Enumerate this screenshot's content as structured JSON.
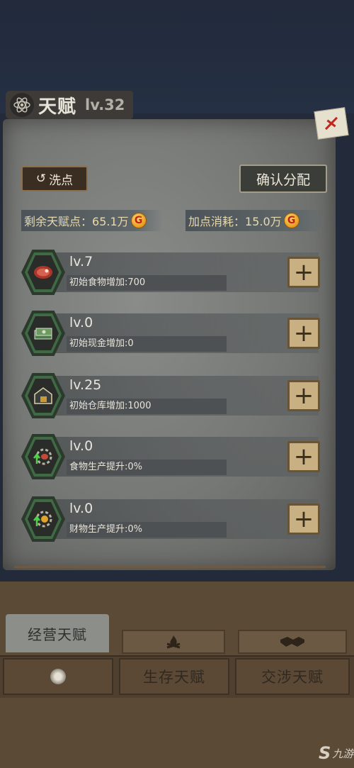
{
  "header": {
    "title": "天赋",
    "level": "lv.32"
  },
  "actions": {
    "reset_label": "洗点",
    "confirm_label": "确认分配"
  },
  "stats": {
    "remaining_label": "剩余天赋点：",
    "remaining_value": "65.1万",
    "cost_label": "加点消耗：",
    "cost_value": "15.0万",
    "coin_glyph": "G"
  },
  "talents": [
    {
      "icon": "meat-icon",
      "level": "lv.7",
      "desc": "初始食物增加:700"
    },
    {
      "icon": "cash-icon",
      "level": "lv.0",
      "desc": "初始现金增加:0"
    },
    {
      "icon": "warehouse-icon",
      "level": "lv.25",
      "desc": "初始仓库增加:1000"
    },
    {
      "icon": "food-production-icon",
      "level": "lv.0",
      "desc": "食物生产提升:0%"
    },
    {
      "icon": "goods-production-icon",
      "level": "lv.0",
      "desc": "财物生产提升:0%"
    }
  ],
  "tabs": {
    "active": "经营天赋",
    "fire_icon": "campfire-icon",
    "handshake_icon": "handshake-icon"
  },
  "bottom": {
    "survival": "生存天赋",
    "negotiation": "交涉天赋"
  },
  "watermark": {
    "mark": "S",
    "text": "九游"
  },
  "colors": {
    "accent_green": "#3f6a44",
    "plus_button": "#c9b083",
    "coin": "#e89a1c"
  }
}
